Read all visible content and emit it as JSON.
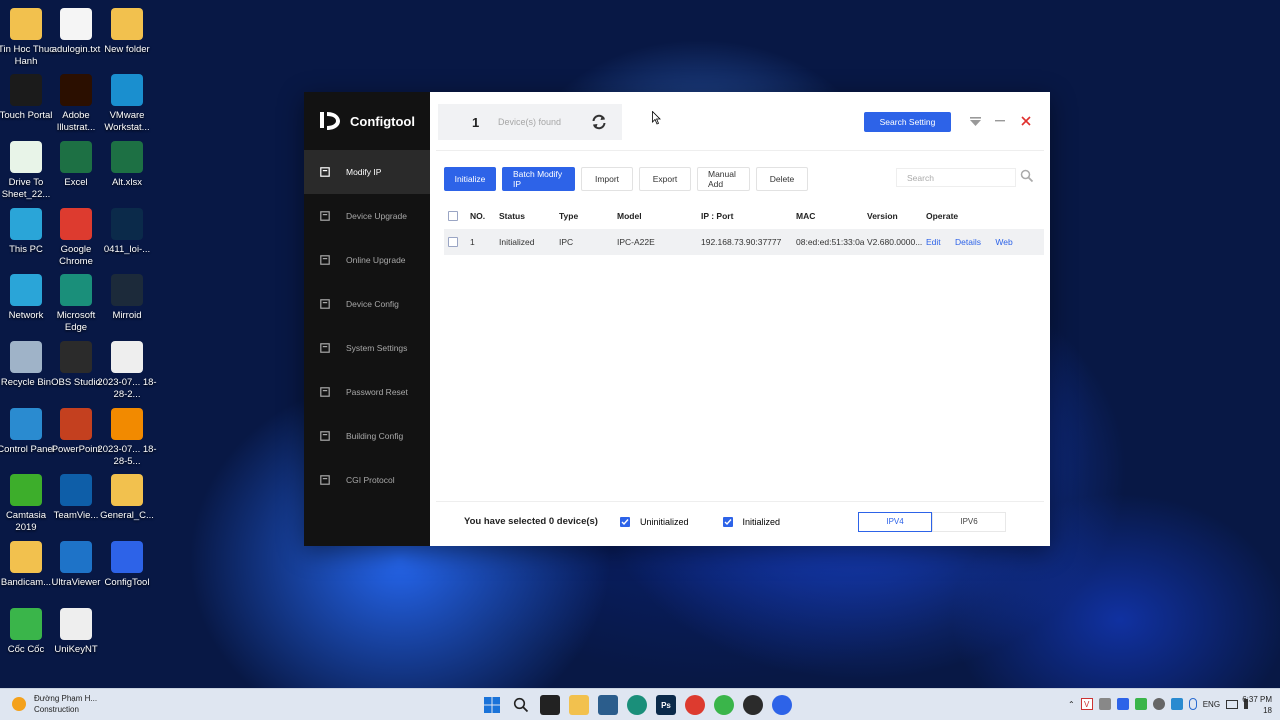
{
  "desktop_icons": [
    {
      "name": "folder-icon",
      "label": "Tin Hoc Thuc Hanh",
      "color": "#f2c14e"
    },
    {
      "name": "text-file-icon",
      "label": "adulogin.txt",
      "color": "#f5f5f5"
    },
    {
      "name": "folder-icon",
      "label": "New folder",
      "color": "#f2c14e"
    },
    {
      "name": "touch-portal-icon",
      "label": "Touch Portal",
      "color": "#1b1b1b"
    },
    {
      "name": "illustrator-icon",
      "label": "Adobe Illustrat...",
      "color": "#2b0f00"
    },
    {
      "name": "vmware-icon",
      "label": "VMware Workstat...",
      "color": "#1a8fcf"
    },
    {
      "name": "drive-to-sheet-icon",
      "label": "Drive To Sheet_22...",
      "color": "#e8f4e8"
    },
    {
      "name": "excel-icon",
      "label": "Excel",
      "color": "#1d7044"
    },
    {
      "name": "excel-file-icon",
      "label": "Alt.xlsx",
      "color": "#1d7044"
    },
    {
      "name": "this-pc-icon",
      "label": "This PC",
      "color": "#2aa5d8"
    },
    {
      "name": "chrome-icon",
      "label": "Google Chrome",
      "color": "#dd3b2f"
    },
    {
      "name": "psd-file-icon",
      "label": "0411_loi-...",
      "color": "#0b2a4a"
    },
    {
      "name": "network-icon",
      "label": "Network",
      "color": "#2aa5d8"
    },
    {
      "name": "edge-icon",
      "label": "Microsoft Edge",
      "color": "#1a8f7a"
    },
    {
      "name": "mirroid-icon",
      "label": "Mirroid",
      "color": "#1c2a3a"
    },
    {
      "name": "recycle-bin-icon",
      "label": "Recycle Bin",
      "color": "#9fb3c8"
    },
    {
      "name": "obs-icon",
      "label": "OBS Studio",
      "color": "#2b2b2b"
    },
    {
      "name": "video-file-icon",
      "label": "2023-07... 18-28-2...",
      "color": "#eeeeee"
    },
    {
      "name": "control-panel-icon",
      "label": "Control Panel",
      "color": "#2a8bd0"
    },
    {
      "name": "powerpoint-icon",
      "label": "PowerPoint",
      "color": "#c4401f"
    },
    {
      "name": "vlc-icon",
      "label": "2023-07... 18-28-5...",
      "color": "#f28a00"
    },
    {
      "name": "camtasia-icon",
      "label": "Camtasia 2019",
      "color": "#3dae2b"
    },
    {
      "name": "teamviewer-icon",
      "label": "TeamVie...",
      "color": "#0e5ea8"
    },
    {
      "name": "folder-icon",
      "label": "General_C...",
      "color": "#f2c14e"
    },
    {
      "name": "bandicam-folder-icon",
      "label": "Bandicam...",
      "color": "#f2c14e"
    },
    {
      "name": "ultraviewer-icon",
      "label": "UltraViewer",
      "color": "#1e73c8"
    },
    {
      "name": "configtool-icon",
      "label": "ConfigTool",
      "color": "#2d63e8"
    },
    {
      "name": "coccoc-icon",
      "label": "Cốc Cốc",
      "color": "#3ab54a"
    },
    {
      "name": "unikey-icon",
      "label": "UniKeyNT",
      "color": "#eeeeee"
    }
  ],
  "app": {
    "brand": "Configtool",
    "nav": [
      {
        "label": "Modify IP",
        "icon": "modify-ip-icon"
      },
      {
        "label": "Device Upgrade",
        "icon": "device-upgrade-icon"
      },
      {
        "label": "Online Upgrade",
        "icon": "online-upgrade-icon"
      },
      {
        "label": "Device Config",
        "icon": "device-config-icon"
      },
      {
        "label": "System Settings",
        "icon": "system-settings-icon"
      },
      {
        "label": "Password Reset",
        "icon": "password-reset-icon"
      },
      {
        "label": "Building Config",
        "icon": "building-config-icon"
      },
      {
        "label": "CGI Protocol",
        "icon": "cgi-protocol-icon"
      }
    ],
    "devices_found_count": "1",
    "devices_found_label": "Device(s) found",
    "search_setting_label": "Search Setting",
    "toolbar": {
      "initialize": "Initialize",
      "batch_modify_ip": "Batch Modify IP",
      "import": "Import",
      "export": "Export",
      "manual_add": "Manual Add",
      "delete": "Delete"
    },
    "search_placeholder": "Search",
    "table": {
      "headers": [
        "NO.",
        "Status",
        "Type",
        "Model",
        "IP : Port",
        "MAC",
        "Version",
        "Operate"
      ],
      "rows": [
        {
          "no": "1",
          "status": "Initialized",
          "type": "IPC",
          "model": "IPC-A22E",
          "ip_port": "192.168.73.90:37777",
          "mac": "08:ed:ed:51:33:0a",
          "version": "V2.680.0000...",
          "edit": "Edit",
          "details": "Details",
          "web": "Web"
        }
      ]
    },
    "footer": {
      "selected_prefix": "You have selected",
      "selected_count": "0",
      "selected_suffix": "device(s)",
      "uninitialized": "Uninitialized",
      "initialized": "Initialized",
      "ipv4": "IPV4",
      "ipv6": "IPV6"
    }
  },
  "taskbar": {
    "weather_title": "Đường Phạm H...",
    "weather_subtitle": "Construction",
    "lang": "ENG",
    "time": "6:37 PM",
    "date": "18"
  },
  "colors": {
    "accent": "#2d63e8",
    "sidebar_bg": "#121212",
    "close": "#e0302d"
  }
}
